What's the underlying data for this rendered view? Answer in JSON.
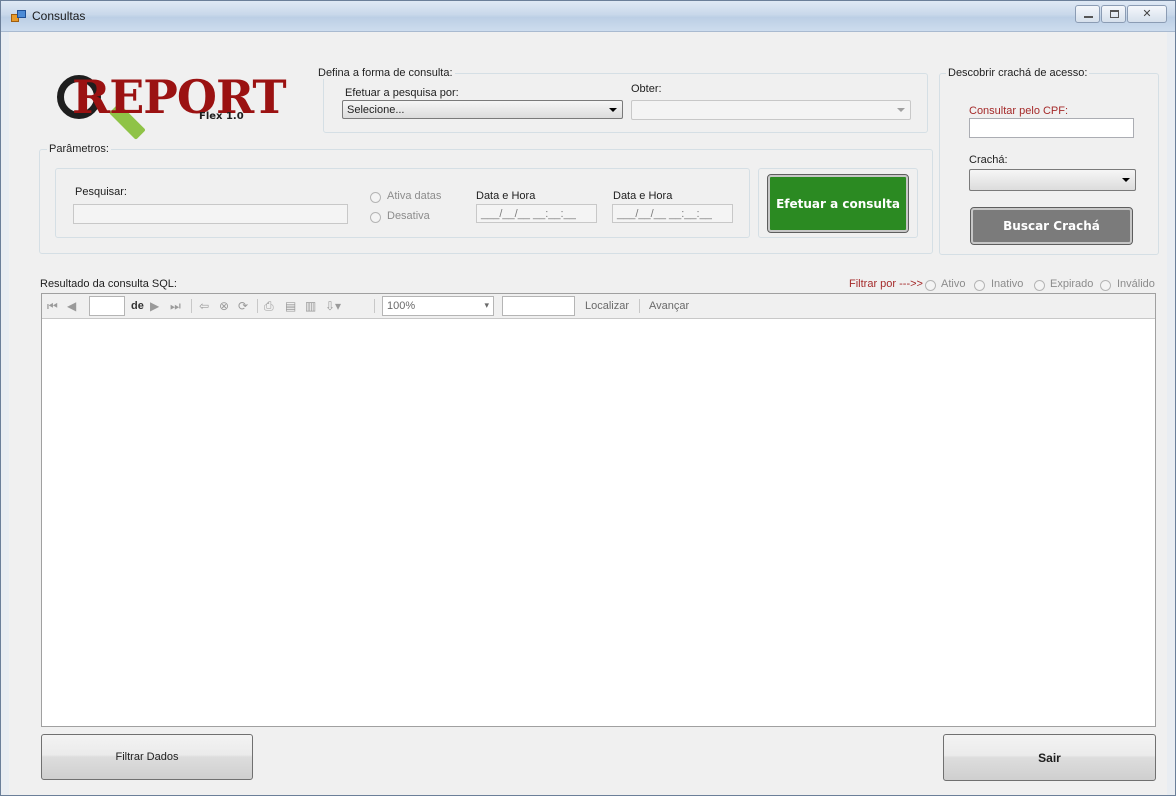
{
  "window": {
    "title": "Consultas"
  },
  "logo": {
    "brand": "REPORT",
    "version": "Flex 1.0"
  },
  "consulta": {
    "group_title": "Defina a forma de consulta:",
    "efetuar_label": "Efetuar a pesquisa por:",
    "efetuar_value": "Selecione...",
    "obter_label": "Obter:",
    "obter_value": ""
  },
  "parametros": {
    "group_title": "Parâmetros:",
    "pesquisar_label": "Pesquisar:",
    "pesquisar_value": "",
    "radio_ativa": "Ativa datas",
    "radio_desativa": "Desativa",
    "data_hora_1_label": "Data e Hora",
    "data_hora_1_value": "___/__/__ __:__:__",
    "data_hora_2_label": "Data e Hora",
    "data_hora_2_value": "___/__/__ __:__:__",
    "consultar_button": "Efetuar a consulta"
  },
  "cracha": {
    "group_title": "Descobrir crachá de acesso:",
    "cpf_label": "Consultar pelo CPF:",
    "cpf_value": "",
    "cracha_label": "Crachá:",
    "cracha_value": "",
    "buscar_button": "Buscar Crachá"
  },
  "resultado": {
    "title": "Resultado da consulta SQL:",
    "filtrar_label": "Filtrar por --->>",
    "filters": [
      "Ativo",
      "Inativo",
      "Expirado",
      "Inválido"
    ]
  },
  "viewer_toolbar": {
    "page_value": "",
    "de_label": "de",
    "zoom_value": "100%",
    "find_value": "",
    "localizar": "Localizar",
    "avancar": "Avançar"
  },
  "footer": {
    "filtrar_button": "Filtrar Dados",
    "sair_button": "Sair"
  },
  "colors": {
    "consultar_bg": "#2b8a22",
    "buscar_bg": "#7b7b7b",
    "logo_red": "#9b1212",
    "logo_green": "#8fc347",
    "cpf_label": "#a52a2a",
    "filtrar_label": "#a52a2a"
  },
  "icons": {
    "app": "app-icon",
    "minimize": "minimize-icon",
    "maximize": "maximize-icon",
    "close": "close-icon"
  }
}
